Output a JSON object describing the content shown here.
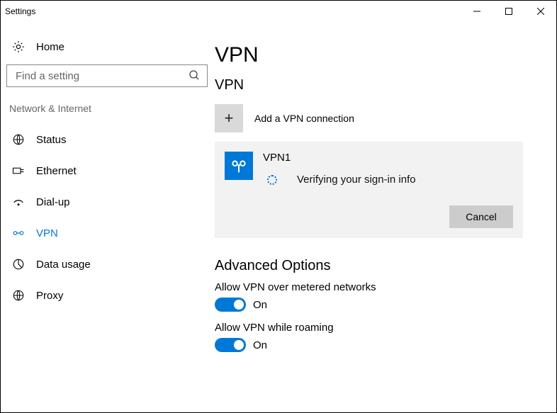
{
  "window": {
    "title": "Settings"
  },
  "search": {
    "placeholder": "Find a setting"
  },
  "sidebar": {
    "home": "Home",
    "section": "Network & Internet",
    "items": [
      {
        "label": "Status",
        "icon": "status"
      },
      {
        "label": "Ethernet",
        "icon": "ethernet"
      },
      {
        "label": "Dial-up",
        "icon": "dialup"
      },
      {
        "label": "VPN",
        "icon": "vpn",
        "active": true
      },
      {
        "label": "Data usage",
        "icon": "datausage"
      },
      {
        "label": "Proxy",
        "icon": "proxy"
      }
    ]
  },
  "main": {
    "title": "VPN",
    "subheading": "VPN",
    "add_label": "Add a VPN connection",
    "connection": {
      "name": "VPN1",
      "status": "Verifying your sign-in info",
      "cancel_label": "Cancel"
    },
    "advanced": {
      "heading": "Advanced Options",
      "opt1_label": "Allow VPN over metered networks",
      "opt1_state": "On",
      "opt2_label": "Allow VPN while roaming",
      "opt2_state": "On"
    }
  }
}
